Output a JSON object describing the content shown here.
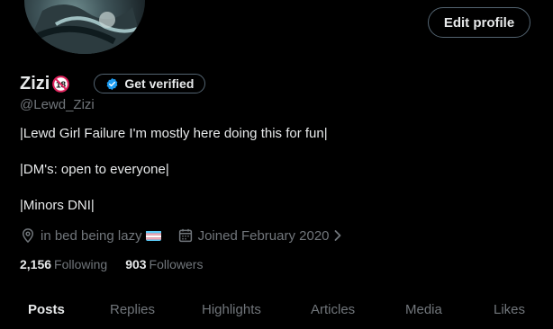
{
  "profile": {
    "name": "Zizi",
    "age_badge_text": "18",
    "handle": "@Lewd_Zizi",
    "bio_lines": [
      "|Lewd Girl Failure I'm mostly here doing this for fun|",
      "|DM's: open to everyone|",
      "|Minors DNI|"
    ],
    "location": "in bed being lazy",
    "joined": "Joined February 2020",
    "following_count": "2,156",
    "following_label": "Following",
    "followers_count": "903",
    "followers_label": "Followers"
  },
  "buttons": {
    "edit_profile": "Edit profile",
    "get_verified": "Get verified"
  },
  "icons": {
    "location": "location-pin-icon",
    "calendar": "calendar-icon",
    "chevron": "chevron-right-icon",
    "verified": "verified-check-icon",
    "flag": "transgender-flag-icon",
    "age": "no-under-18-icon"
  },
  "tabs": [
    {
      "label": "Posts",
      "active": true
    },
    {
      "label": "Replies",
      "active": false
    },
    {
      "label": "Highlights",
      "active": false
    },
    {
      "label": "Articles",
      "active": false
    },
    {
      "label": "Media",
      "active": false
    },
    {
      "label": "Likes",
      "active": false
    }
  ],
  "colors": {
    "background": "#000000",
    "text_primary": "#e7e9ea",
    "text_secondary": "#71767b",
    "border": "#536471",
    "verified_blue": "#1d9bf0",
    "age_red": "#e0245e"
  }
}
